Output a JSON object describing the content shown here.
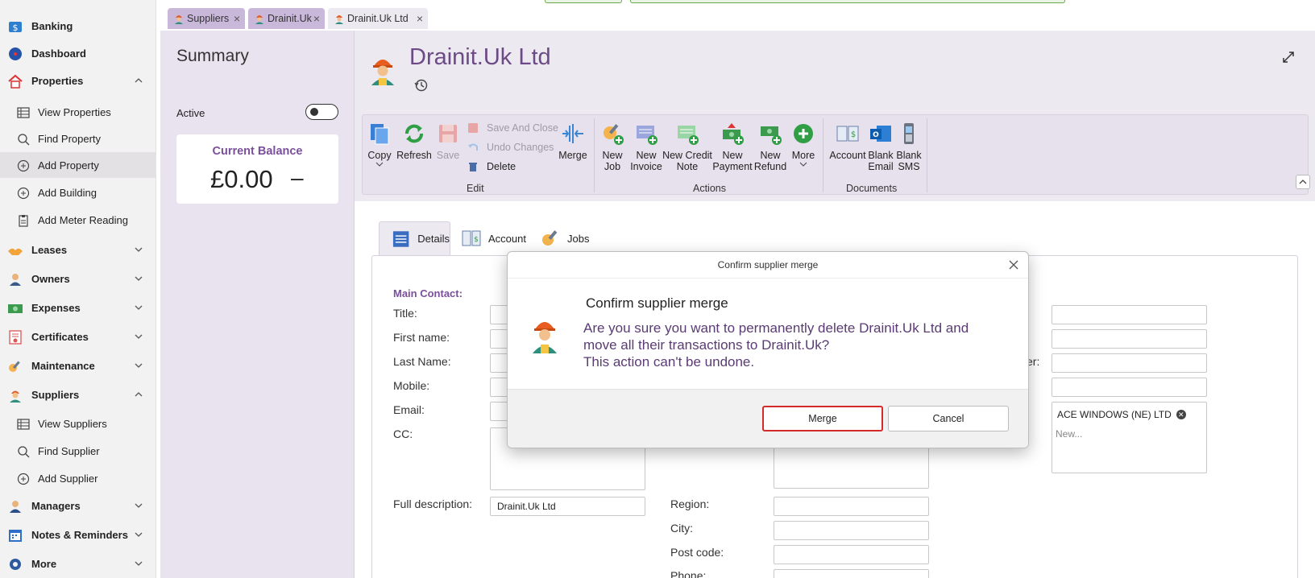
{
  "sidebar": {
    "items": [
      {
        "label": "Banking",
        "icon": "bank-icon"
      },
      {
        "label": "Dashboard",
        "icon": "dashboard-icon"
      },
      {
        "label": "Properties",
        "icon": "house-icon"
      },
      {
        "label": "View Properties",
        "icon": "table-icon"
      },
      {
        "label": "Find Property",
        "icon": "search-icon"
      },
      {
        "label": "Add Property",
        "icon": "plus-circle-icon"
      },
      {
        "label": "Add Building",
        "icon": "plus-circle-icon"
      },
      {
        "label": "Add Meter Reading",
        "icon": "clipboard-icon"
      },
      {
        "label": "Leases",
        "icon": "handshake-icon"
      },
      {
        "label": "Owners",
        "icon": "person-icon"
      },
      {
        "label": "Expenses",
        "icon": "money-icon"
      },
      {
        "label": "Certificates",
        "icon": "certificate-icon"
      },
      {
        "label": "Maintenance",
        "icon": "wrench-icon"
      },
      {
        "label": "Suppliers",
        "icon": "worker-icon"
      },
      {
        "label": "View Suppliers",
        "icon": "table-icon"
      },
      {
        "label": "Find Supplier",
        "icon": "search-icon"
      },
      {
        "label": "Add Supplier",
        "icon": "plus-circle-icon"
      },
      {
        "label": "Managers",
        "icon": "manager-icon"
      },
      {
        "label": "Notes & Reminders",
        "icon": "calendar-icon"
      },
      {
        "label": "More",
        "icon": "gear-icon"
      }
    ]
  },
  "tabs": [
    {
      "label": "Suppliers"
    },
    {
      "label": "Drainit.Uk"
    },
    {
      "label": "Drainit.Uk Ltd"
    }
  ],
  "summary": {
    "title": "Summary",
    "active_label": "Active",
    "balance_title": "Current Balance",
    "balance_value": "£0.00",
    "balance_dash": "–"
  },
  "header": {
    "title": "Drainit.Uk Ltd"
  },
  "ribbon": {
    "copy": "Copy",
    "refresh": "Refresh",
    "save": "Save",
    "save_and_close": "Save And Close",
    "undo_changes": "Undo Changes",
    "delete": "Delete",
    "merge": "Merge",
    "edit_group": "Edit",
    "new_job": "New\nJob",
    "new_invoice": "New\nInvoice",
    "new_credit_note": "New Credit\nNote",
    "new_payment": "New\nPayment",
    "new_refund": "New\nRefund",
    "more": "More",
    "actions_group": "Actions",
    "account": "Account",
    "blank_email": "Blank\nEmail",
    "blank_sms": "Blank\nSMS",
    "documents_group": "Documents"
  },
  "content_tabs": [
    {
      "label": "Details"
    },
    {
      "label": "Account"
    },
    {
      "label": "Jobs"
    }
  ],
  "form": {
    "main_contact": "Main Contact:",
    "title": "Title:",
    "first_name": "First name:",
    "last_name": "Last Name:",
    "mobile": "Mobile:",
    "email": "Email:",
    "cc": "CC:",
    "full_description": "Full description:",
    "full_description_value": "Drainit.Uk Ltd",
    "region": "Region:",
    "city": "City:",
    "post_code": "Post code:",
    "phone": "Phone:",
    "er_fragment": "er:",
    "tag_value": "ACE WINDOWS (NE) LTD",
    "tag_new": "New..."
  },
  "modal": {
    "title": "Confirm supplier merge",
    "heading": "Confirm supplier merge",
    "message_line1": "Are you sure you want to permanently delete Drainit.Uk Ltd and",
    "message_line2": "move all their transactions to Drainit.Uk?",
    "message_line3": "This action can't be undone.",
    "merge_label": "Merge",
    "cancel_label": "Cancel"
  },
  "colors": {
    "accent": "#7a4f9b",
    "panel": "#ede9f1",
    "highlight": "#d42a2a"
  }
}
